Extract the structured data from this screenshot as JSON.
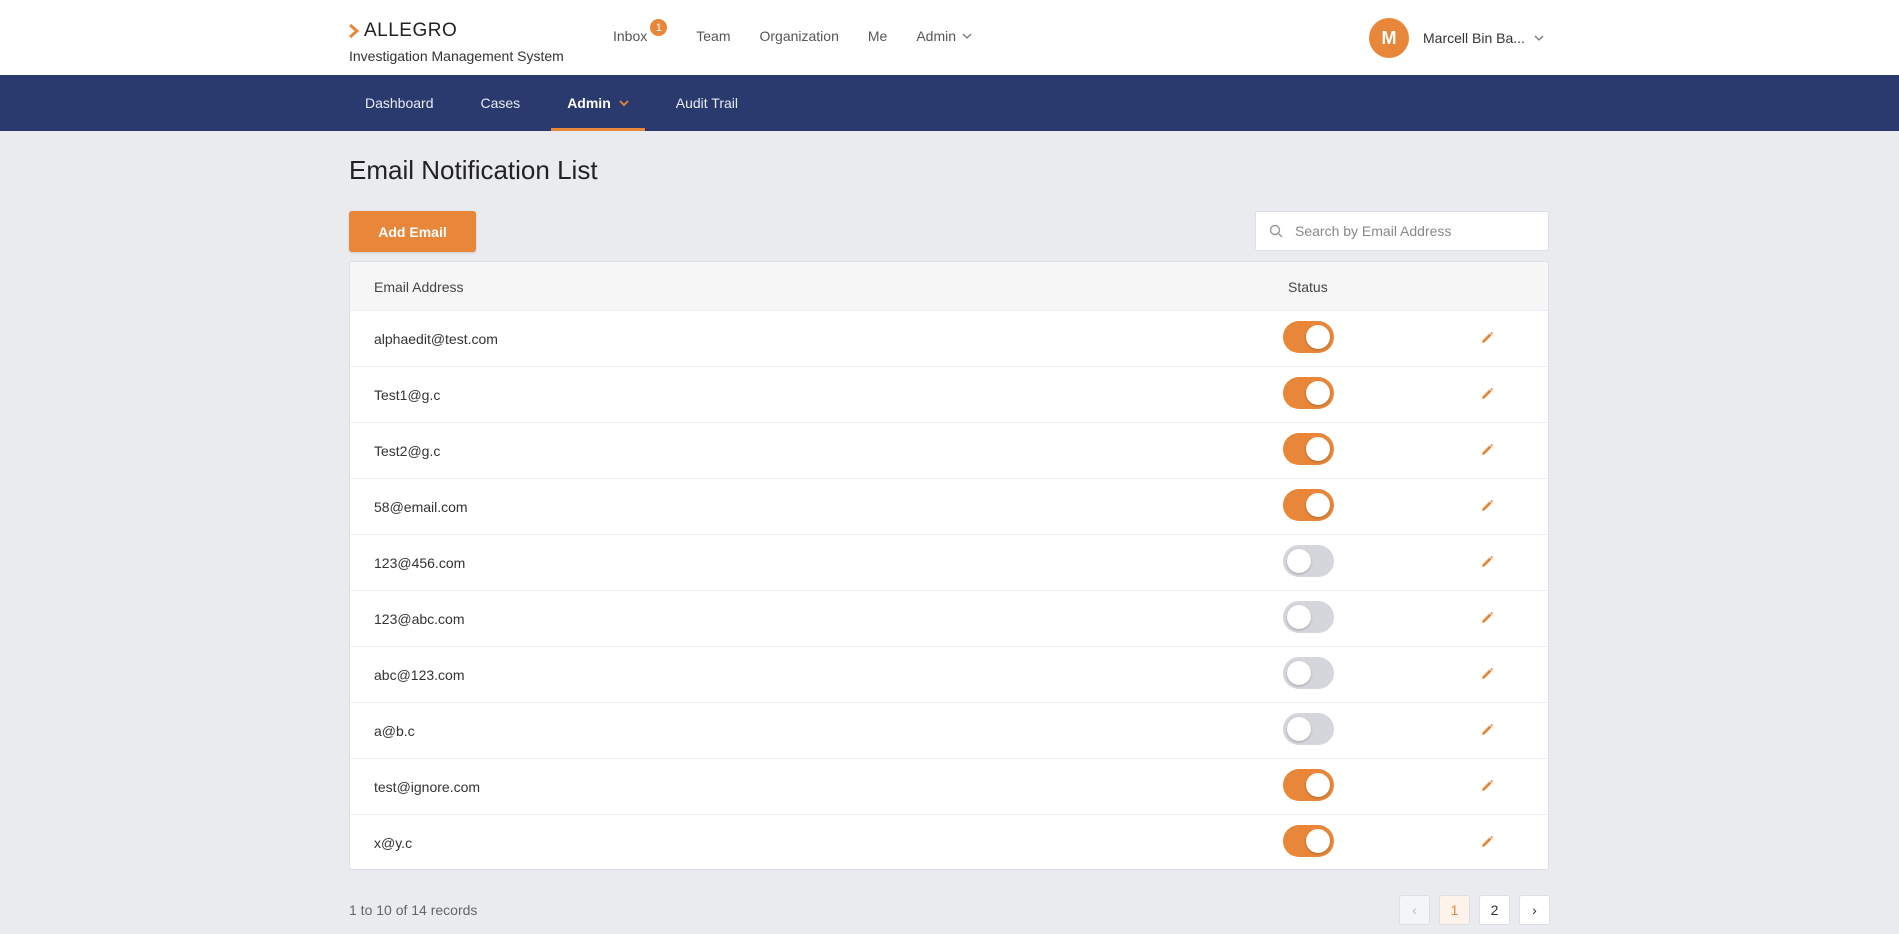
{
  "brand": {
    "name": "ALLEGRO",
    "subtitle": "Investigation Management System"
  },
  "top_nav": {
    "items": [
      {
        "label": "Inbox",
        "badge": "1"
      },
      {
        "label": "Team"
      },
      {
        "label": "Organization"
      },
      {
        "label": "Me"
      },
      {
        "label": "Admin"
      }
    ]
  },
  "user": {
    "initial": "M",
    "name": "Marcell Bin Ba..."
  },
  "main_nav": {
    "items": [
      {
        "label": "Dashboard"
      },
      {
        "label": "Cases"
      },
      {
        "label": "Admin",
        "active": true
      },
      {
        "label": "Audit Trail"
      }
    ]
  },
  "page": {
    "title": "Email Notification List"
  },
  "toolbar": {
    "add_label": "Add Email"
  },
  "search": {
    "placeholder": "Search by Email Address"
  },
  "table": {
    "headers": {
      "email": "Email Address",
      "status": "Status"
    },
    "rows": [
      {
        "email": "alphaedit@test.com",
        "active": true
      },
      {
        "email": "Test1@g.c",
        "active": true
      },
      {
        "email": "Test2@g.c",
        "active": true
      },
      {
        "email": "58@email.com",
        "active": true
      },
      {
        "email": "123@456.com",
        "active": false
      },
      {
        "email": "123@abc.com",
        "active": false
      },
      {
        "email": "abc@123.com",
        "active": false
      },
      {
        "email": "a@b.c",
        "active": false
      },
      {
        "email": "test@ignore.com",
        "active": true
      },
      {
        "email": "x@y.c",
        "active": true
      }
    ]
  },
  "pagination": {
    "summary": "1 to 10 of 14 records",
    "prev": "‹",
    "next": "›",
    "pages": [
      "1",
      "2"
    ],
    "current_page": "1"
  },
  "colors": {
    "accent": "#e8873a",
    "nav_bg": "#2b3a6e",
    "toggle_off": "#d4d6db"
  },
  "icons": {
    "edit": "pencil-icon",
    "search": "search-icon",
    "brand": "chevron-right-icon",
    "dropdown": "chevron-down-icon"
  }
}
